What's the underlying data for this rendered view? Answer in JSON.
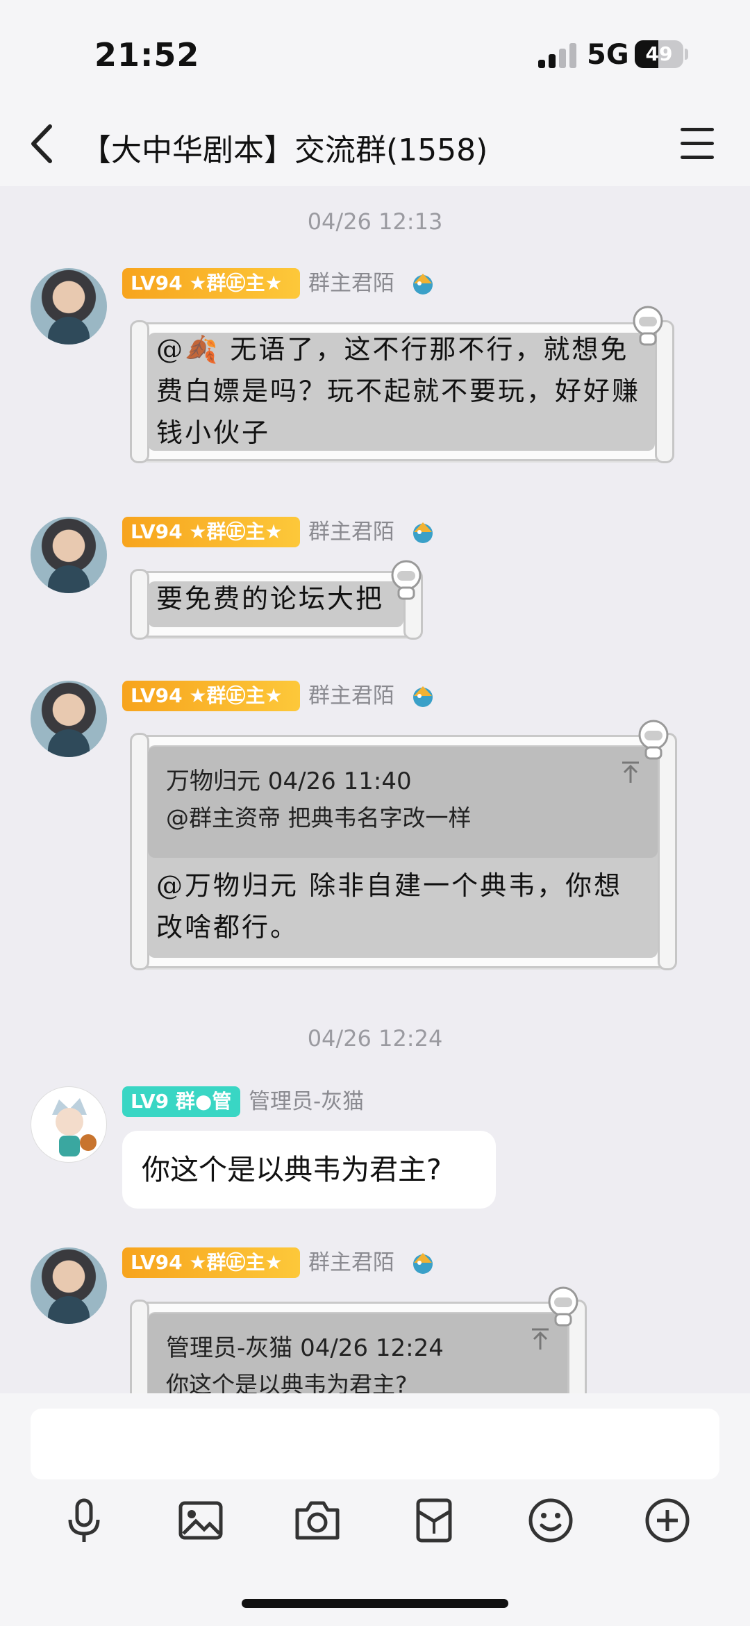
{
  "status": {
    "time": "21:52",
    "network": "5G",
    "battery": "49",
    "battery_level": 0.49
  },
  "header": {
    "title": "【大中华剧本】交流群(1558)"
  },
  "messages": {
    "ts1": "04/26 12:13",
    "m1": {
      "badge": "LV94 ★群㊣主★",
      "sender": "群主君陌",
      "text": "@🍂  无语了，这不行那不行，就想免费白嫖是吗？玩不起就不要玩，好好赚钱小伙子"
    },
    "m2": {
      "badge": "LV94 ★群㊣主★",
      "sender": "群主君陌",
      "text": "要免费的论坛大把"
    },
    "m3": {
      "badge": "LV94 ★群㊣主★",
      "sender": "群主君陌",
      "quote_head": "万物归元 04/26 11:40",
      "quote_body": "@群主资帝 把典韦名字改一样",
      "text": "@万物归元 除非自建一个典韦，你想改啥都行。"
    },
    "ts2": "04/26 12:24",
    "m4": {
      "badge": "LV9 群●管",
      "sender": "管理员-灰猫",
      "text": "你这个是以典韦为君主?"
    },
    "m5": {
      "badge": "LV94 ★群㊣主★",
      "sender": "群主君陌",
      "quote_head": "管理员-灰猫 04/26 12:24",
      "quote_body": "你这个是以典韦为君主?"
    }
  },
  "input": {
    "placeholder": ""
  },
  "toolbar": [
    "mic-icon",
    "image-icon",
    "camera-icon",
    "redpacket-icon",
    "emoji-icon",
    "plus-icon"
  ]
}
